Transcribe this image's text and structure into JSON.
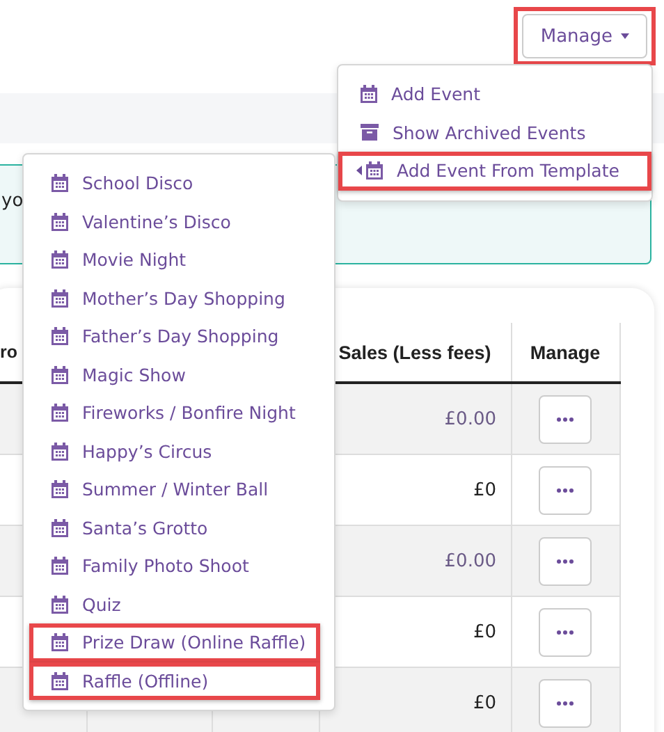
{
  "manage_button": {
    "label": "Manage",
    "highlighted": true
  },
  "alert": {
    "text": "yo"
  },
  "manage_menu": {
    "items": [
      {
        "label": "Add Event",
        "kind": "calendar",
        "submenu": false,
        "highlighted": false
      },
      {
        "label": "Show Archived Events",
        "kind": "archive",
        "submenu": false,
        "highlighted": false
      },
      {
        "label": "Add Event From Template",
        "kind": "calendar",
        "submenu": true,
        "highlighted": true
      }
    ]
  },
  "template_menu": {
    "items": [
      {
        "label": "School Disco",
        "highlighted": false
      },
      {
        "label": "Valentine’s Disco",
        "highlighted": false
      },
      {
        "label": "Movie Night",
        "highlighted": false
      },
      {
        "label": "Mother’s Day Shopping",
        "highlighted": false
      },
      {
        "label": "Father’s Day Shopping",
        "highlighted": false
      },
      {
        "label": "Magic Show",
        "highlighted": false
      },
      {
        "label": "Fireworks / Bonfire Night",
        "highlighted": false
      },
      {
        "label": "Happy’s Circus",
        "highlighted": false
      },
      {
        "label": "Summer / Winter Ball",
        "highlighted": false
      },
      {
        "label": "Santa’s Grotto",
        "highlighted": false
      },
      {
        "label": "Family Photo Shoot",
        "highlighted": false
      },
      {
        "label": "Quiz",
        "highlighted": false
      },
      {
        "label": "Prize Draw (Online Raffle)",
        "highlighted": true
      },
      {
        "label": "Raffle (Offline)",
        "highlighted": true
      }
    ]
  },
  "table": {
    "columns": [
      "ro",
      "Sales (Less fees)",
      "Manage"
    ],
    "rows": [
      {
        "sales": "£0.00",
        "muted": true
      },
      {
        "sales": "£0",
        "muted": false
      },
      {
        "sales": "£0.00",
        "muted": true
      },
      {
        "sales": "£0",
        "muted": false
      },
      {
        "sales": "£0",
        "muted": false
      }
    ]
  }
}
